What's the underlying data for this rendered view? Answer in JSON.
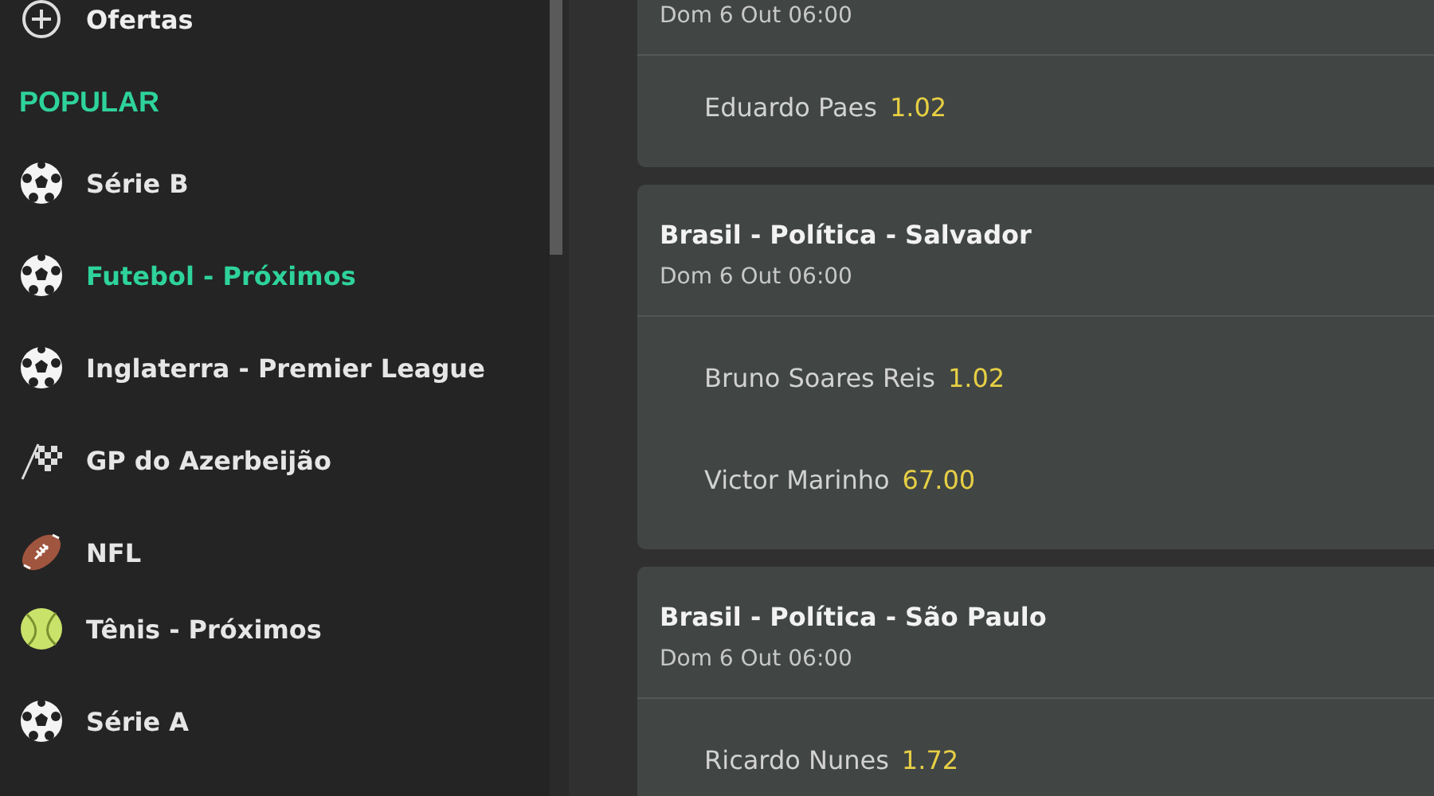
{
  "sidebar": {
    "top_item": {
      "label": "Ofertas"
    },
    "section_title": "POPULAR",
    "items": [
      {
        "label": "Série B",
        "kind": "soccer",
        "selected": false
      },
      {
        "label": "Futebol - Próximos",
        "kind": "soccer",
        "selected": true
      },
      {
        "label": "Inglaterra - Premier League",
        "kind": "soccer",
        "selected": false
      },
      {
        "label": "GP do Azerbeijão",
        "kind": "flag",
        "selected": false
      },
      {
        "label": "NFL",
        "kind": "football",
        "selected": false
      },
      {
        "label": "Tênis - Próximos",
        "kind": "tennis",
        "selected": false
      },
      {
        "label": "Série A",
        "kind": "soccer",
        "selected": false
      }
    ]
  },
  "events": [
    {
      "date": "Dom 6 Out 06:00",
      "selections": [
        {
          "name": "Eduardo Paes",
          "odds": "1.02"
        }
      ]
    },
    {
      "title": "Brasil - Política - Salvador",
      "date": "Dom 6 Out 06:00",
      "selections": [
        {
          "name": "Bruno Soares Reis",
          "odds": "1.02"
        },
        {
          "name": "Victor Marinho",
          "odds": "67.00"
        }
      ]
    },
    {
      "title": "Brasil - Política - São Paulo",
      "date": "Dom 6 Out 06:00",
      "selections": [
        {
          "name": "Ricardo Nunes",
          "odds": "1.72"
        }
      ]
    }
  ]
}
